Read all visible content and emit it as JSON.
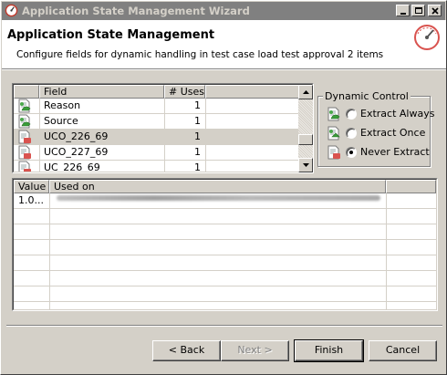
{
  "window": {
    "title": "Application State Management Wizard"
  },
  "header": {
    "title": "Application State Management",
    "subtitle": "Configure fields for dynamic handling in test case load test approval 2 items"
  },
  "fields_table": {
    "columns": [
      "Field",
      "# Uses"
    ],
    "rows": [
      {
        "field": "Reason",
        "uses": "1",
        "icon": "extract-always-icon",
        "selected": false
      },
      {
        "field": "Source",
        "uses": "1",
        "icon": "extract-always-icon",
        "selected": false
      },
      {
        "field": "UCO_226_69",
        "uses": "1",
        "icon": "never-extract-icon",
        "selected": true
      },
      {
        "field": "UCO_227_69",
        "uses": "1",
        "icon": "never-extract-icon",
        "selected": false
      },
      {
        "field": "UC_226_69",
        "uses": "1",
        "icon": "never-extract-icon",
        "selected": false
      }
    ]
  },
  "dynamic_control": {
    "label": "Dynamic Control",
    "options": [
      {
        "label": "Extract Always",
        "checked": false,
        "icon": "extract-always-icon"
      },
      {
        "label": "Extract Once",
        "checked": false,
        "icon": "extract-once-icon"
      },
      {
        "label": "Never Extract",
        "checked": true,
        "icon": "never-extract-icon"
      }
    ]
  },
  "usage_table": {
    "columns": [
      "Value",
      "Used on"
    ],
    "rows": [
      {
        "value": "1.0...",
        "used_on": ""
      }
    ]
  },
  "buttons": {
    "back": "< Back",
    "next": "Next >",
    "finish": "Finish",
    "cancel": "Cancel"
  },
  "colors": {
    "face": "#d4d0c8",
    "titlebar_inactive": "#808080",
    "accent_red": "#d9534f"
  }
}
